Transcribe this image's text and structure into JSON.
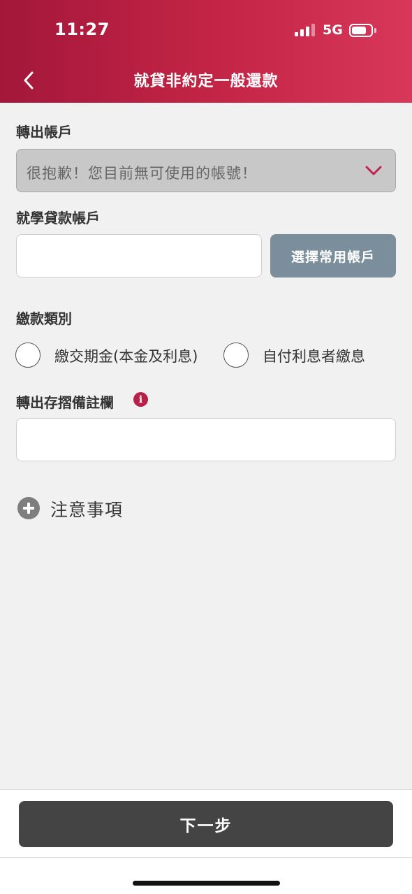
{
  "status_bar": {
    "time": "11:27",
    "network": "5G"
  },
  "header": {
    "title": "就貸非約定一般還款",
    "back_icon": "chevron-left-icon"
  },
  "form": {
    "from_account": {
      "label": "轉出帳戶",
      "value": "很抱歉！您目前無可使用的帳號！",
      "chevron_icon": "chevron-down-icon"
    },
    "loan_account": {
      "label": "就學貸款帳戶",
      "value": "",
      "select_button_label": "選擇常用帳戶"
    },
    "payment_type": {
      "label": "繳款類別",
      "options": [
        {
          "label": "繳交期金(本金及利息)",
          "selected": false
        },
        {
          "label": "自付利息者繳息",
          "selected": false
        }
      ]
    },
    "memo": {
      "label": "轉出存摺備註欄",
      "info_icon": "info-icon",
      "value": ""
    }
  },
  "notes": {
    "label": "注意事項",
    "icon": "plus-circle-icon"
  },
  "footer": {
    "next_label": "下一步"
  },
  "colors": {
    "header_start": "#a3173a",
    "header_end": "#d8375a",
    "accent": "#b8204a",
    "select_button": "#7a8f9b",
    "next_button": "#444444"
  }
}
